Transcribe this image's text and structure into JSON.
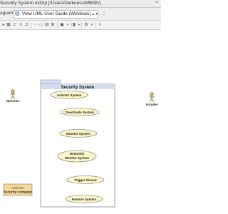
{
  "window": {
    "title": "Security System.mdzip [/Users/Darkness/MBSE/]",
    "close_label": "×"
  },
  "toolbar": {
    "diagram_label": "agram",
    "view_combo": "View UML User Guide (Windows)",
    "view_combo_icon": "document-icon"
  },
  "diagram": {
    "system": {
      "name": "Security System"
    },
    "actors": [
      {
        "name": "Operator"
      },
      {
        "name": "Intruder"
      }
    ],
    "use_cases": [
      {
        "lines": [
          "Activate System"
        ]
      },
      {
        "lines": [
          "Deactivate System"
        ]
      },
      {
        "lines": [
          "Monitor System"
        ]
      },
      {
        "lines": [
          "Remotely",
          "Monitor System"
        ]
      },
      {
        "lines": [
          "Trigger Sensor"
        ]
      },
      {
        "lines": [
          "Restore System"
        ]
      }
    ],
    "external": {
      "stereotype": "«external»",
      "name": "Security Company"
    }
  }
}
